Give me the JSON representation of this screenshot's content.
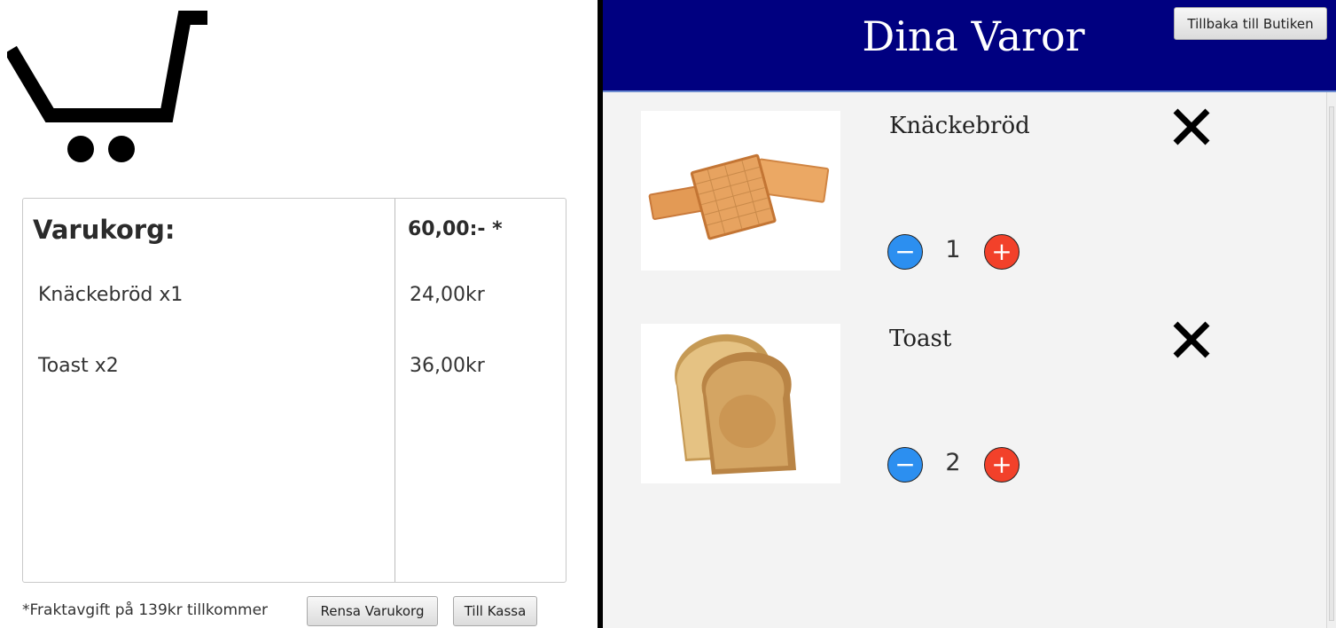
{
  "cart": {
    "title": "Varukorg:",
    "total": "60,00:- *",
    "items": [
      {
        "name": "Knäckebröd x1",
        "price": "24,00kr"
      },
      {
        "name": "Toast x2",
        "price": "36,00kr"
      }
    ],
    "fee_note": "*Fraktavgift på 139kr tillkommer",
    "clear_label": "Rensa Varukorg",
    "checkout_label": "Till Kassa"
  },
  "panel": {
    "title": "Dina Varor",
    "back_label": "Tillbaka till Butiken",
    "header_color": "#000080",
    "products": [
      {
        "name": "Knäckebröd",
        "quantity": "1",
        "image_icon": "crispbread-image"
      },
      {
        "name": "Toast",
        "quantity": "2",
        "image_icon": "toast-image"
      }
    ]
  },
  "icons": {
    "cart": "shopping-cart-icon",
    "remove": "close-icon",
    "decrease": "minus-icon",
    "increase": "plus-icon"
  },
  "colors": {
    "minus_button": "#2c8ff0",
    "plus_button": "#f2412a"
  }
}
